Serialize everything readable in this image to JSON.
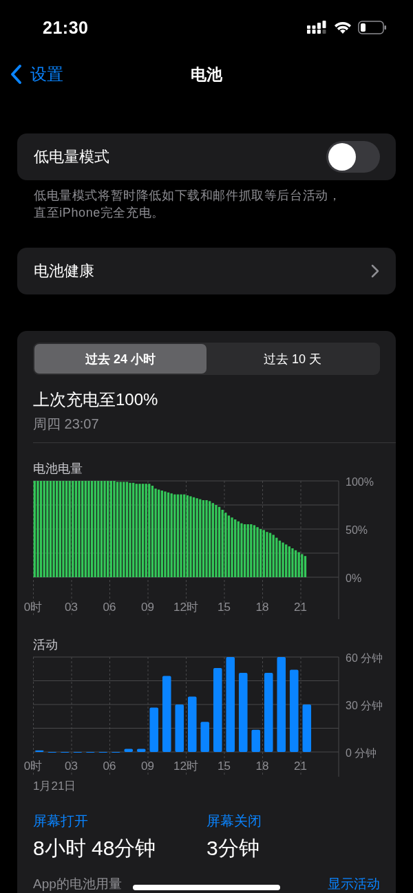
{
  "status_bar": {
    "time": "21:30"
  },
  "nav": {
    "back_label": "设置",
    "title": "电池"
  },
  "low_power": {
    "label": "低电量模式",
    "on": false,
    "footnote": "低电量模式将暂时降低如下载和邮件抓取等后台活动，直至iPhone完全充电。"
  },
  "battery_health": {
    "label": "电池健康"
  },
  "usage": {
    "periods": [
      {
        "label": "过去 24 小时",
        "selected": true
      },
      {
        "label": "过去 10 天",
        "selected": false
      }
    ],
    "last_charge": {
      "title": "上次充电至100%",
      "time": "周四 23:07"
    },
    "battery_chart": {
      "chart_data": {
        "type": "bar",
        "title": "电池电量",
        "grid": true,
        "xlim": [
          0,
          24
        ],
        "ylim": [
          0,
          100
        ],
        "x": [
          0.125,
          0.375,
          0.625,
          0.875,
          1.125,
          1.375,
          1.625,
          1.875,
          2.125,
          2.375,
          2.625,
          2.875,
          3.125,
          3.375,
          3.625,
          3.875,
          4.125,
          4.375,
          4.625,
          4.875,
          5.125,
          5.375,
          5.625,
          5.875,
          6.125,
          6.375,
          6.625,
          6.875,
          7.125,
          7.375,
          7.625,
          7.875,
          8.125,
          8.375,
          8.625,
          8.875,
          9.125,
          9.375,
          9.625,
          9.875,
          10.125,
          10.375,
          10.625,
          10.875,
          11.125,
          11.375,
          11.625,
          11.875,
          12.125,
          12.375,
          12.625,
          12.875,
          13.125,
          13.375,
          13.625,
          13.875,
          14.125,
          14.375,
          14.625,
          14.875,
          15.125,
          15.375,
          15.625,
          15.875,
          16.125,
          16.375,
          16.625,
          16.875,
          17.125,
          17.375,
          17.625,
          17.875,
          18.125,
          18.375,
          18.625,
          18.875,
          19.125,
          19.375,
          19.625,
          19.875,
          20.125,
          20.375,
          20.625,
          20.875,
          21.125,
          21.375
        ],
        "series": [
          {
            "color": "#34c759",
            "values": [
              100,
              100,
              100,
              100,
              100,
              100,
              100,
              100,
              100,
              100,
              100,
              100,
              100,
              100,
              100,
              100,
              100,
              100,
              100,
              100,
              100,
              100,
              100,
              100,
              100,
              100,
              99,
              99,
              99,
              99,
              98,
              98,
              97,
              97,
              97,
              97,
              97,
              95,
              92,
              91,
              90,
              89,
              88,
              87,
              86,
              86,
              86,
              86,
              85,
              84,
              83,
              82,
              81,
              80,
              80,
              79,
              77,
              75,
              73,
              70,
              67,
              64,
              62,
              60,
              58,
              56,
              55,
              55,
              55,
              54,
              52,
              50,
              49,
              47,
              46,
              44,
              41,
              38,
              36,
              34,
              32,
              30,
              28,
              26,
              24,
              22
            ]
          }
        ],
        "xticks": [
          {
            "value": 0,
            "label": "0时"
          },
          {
            "value": 3,
            "label": "03"
          },
          {
            "value": 6,
            "label": "06"
          },
          {
            "value": 9,
            "label": "09"
          },
          {
            "value": 12,
            "label": "12时"
          },
          {
            "value": 15,
            "label": "15"
          },
          {
            "value": 18,
            "label": "18"
          },
          {
            "value": 21,
            "label": "21"
          }
        ],
        "yticks": [
          {
            "value": 0,
            "label": "0%"
          },
          {
            "value": 50,
            "label": "50%"
          },
          {
            "value": 100,
            "label": "100%"
          }
        ]
      }
    },
    "activity_chart": {
      "date": "1月21日",
      "chart_data": {
        "type": "bar",
        "title": "活动",
        "grid": true,
        "xlim": [
          0,
          24
        ],
        "ylim": [
          0,
          60
        ],
        "x": [
          0.5,
          1.5,
          2.5,
          3.5,
          4.5,
          5.5,
          6.5,
          7.5,
          8.5,
          9.5,
          10.5,
          11.5,
          12.5,
          13.5,
          14.5,
          15.5,
          16.5,
          17.5,
          18.5,
          19.5,
          20.5,
          21.5
        ],
        "series": [
          {
            "color": "#0a84ff",
            "values": [
              1,
              0,
              0,
              0,
              0,
              0,
              0,
              2,
              2,
              28,
              48,
              30,
              35,
              19,
              53,
              60,
              50,
              14,
              50,
              60,
              52,
              30
            ]
          }
        ],
        "xticks": [
          {
            "value": 0,
            "label": "0时"
          },
          {
            "value": 3,
            "label": "03"
          },
          {
            "value": 6,
            "label": "06"
          },
          {
            "value": 9,
            "label": "09"
          },
          {
            "value": 12,
            "label": "12时"
          },
          {
            "value": 15,
            "label": "15"
          },
          {
            "value": 18,
            "label": "18"
          },
          {
            "value": 21,
            "label": "21"
          }
        ],
        "yticks": [
          {
            "value": 0,
            "label": "0 分钟"
          },
          {
            "value": 30,
            "label": "30 分钟"
          },
          {
            "value": 60,
            "label": "60 分钟"
          }
        ]
      }
    },
    "screen_on": {
      "label": "屏幕打开",
      "value": "8小时 48分钟"
    },
    "screen_off": {
      "label": "屏幕关闭",
      "value": "3分钟"
    },
    "app_usage": {
      "label": "App的电池用量",
      "action": "显示活动"
    }
  }
}
